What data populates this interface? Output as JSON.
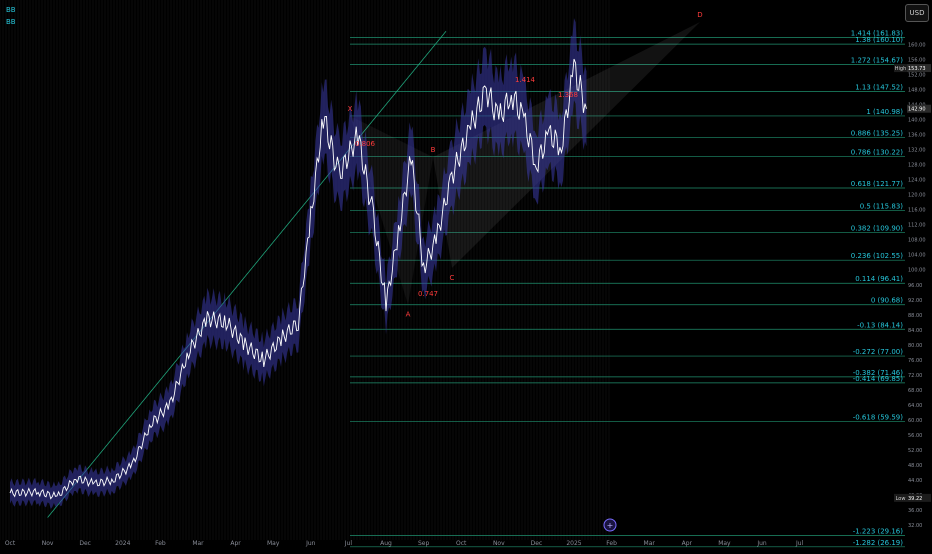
{
  "indicators": [
    "BB",
    "BB"
  ],
  "currency_button": "USD",
  "colors": {
    "background": "#000000",
    "price_line": "#ffffff",
    "band_fill": "#3a3aa8",
    "fib_line": "#1f8f6e",
    "fib_text": "#26c6da",
    "trend_line": "#1fa37a",
    "pattern_label": "#ff3b3b",
    "vertical_grid": "#171717"
  },
  "chart_data": {
    "type": "line",
    "title": "",
    "xlabel": "",
    "ylabel": "",
    "x_tick_labels": [
      "Oct",
      "Nov",
      "Dec",
      "2024",
      "Feb",
      "Mar",
      "Apr",
      "May",
      "Jun",
      "Jul",
      "Aug",
      "Sep",
      "Oct",
      "Nov",
      "Dec",
      "2025",
      "Feb",
      "Mar",
      "Apr",
      "May",
      "Jun",
      "Jul"
    ],
    "y_range": [
      28,
      166
    ],
    "y_tick_labels": [
      "32.00",
      "36.00",
      "40.00",
      "44.00",
      "48.00",
      "52.00",
      "56.00",
      "60.00",
      "64.00",
      "68.00",
      "72.00",
      "76.00",
      "80.00",
      "84.00",
      "88.00",
      "92.00",
      "96.00",
      "100.00",
      "104.00",
      "108.00",
      "112.00",
      "116.00",
      "120.00",
      "124.00",
      "128.00",
      "132.00",
      "136.00",
      "140.00",
      "144.00",
      "148.00",
      "152.00",
      "156.00",
      "160.00"
    ],
    "series": [
      {
        "style": "price",
        "points": [
          [
            "Oct",
            40.5
          ],
          [
            "Nov",
            40.8
          ],
          [
            "Nov",
            39.5
          ],
          [
            "Dec",
            44.5
          ],
          [
            "Dec",
            43.0
          ],
          [
            "2024",
            44.0
          ],
          [
            "2024",
            48.0
          ],
          [
            "Feb",
            59.0
          ],
          [
            "Feb",
            64.0
          ],
          [
            "Mar",
            78.0
          ],
          [
            "Mar",
            87.0
          ],
          [
            "Apr",
            86.0
          ],
          [
            "Apr",
            80.0
          ],
          [
            "May",
            76.0
          ],
          [
            "May",
            82.0
          ],
          [
            "Jun",
            86.0
          ],
          [
            "Jun",
            114.0
          ],
          [
            "Jun",
            141.0
          ],
          [
            "Jul",
            125.0
          ],
          [
            "Jul",
            136.0
          ],
          [
            "Aug",
            114.0
          ],
          [
            "Aug",
            90.7
          ],
          [
            "Aug",
            110.0
          ],
          [
            "Sep",
            130.0
          ],
          [
            "Sep",
            100.5
          ],
          [
            "Sep",
            108.0
          ],
          [
            "Oct",
            125.0
          ],
          [
            "Oct",
            138.0
          ],
          [
            "Nov",
            148.0
          ],
          [
            "Nov",
            140.0
          ],
          [
            "Nov",
            147.0
          ],
          [
            "Dec",
            140.0
          ],
          [
            "Dec",
            128.0
          ],
          [
            "Dec",
            136.0
          ],
          [
            "2025",
            133.0
          ],
          [
            "2025",
            153.73
          ],
          [
            "2025",
            142.9
          ]
        ]
      }
    ],
    "bands_note": "Bollinger Bands overlay around the price line",
    "fib_levels": [
      {
        "ratio": "1.414",
        "price": "161.83"
      },
      {
        "ratio": "1.38",
        "price": "160.10"
      },
      {
        "ratio": "1.272",
        "price": "154.67"
      },
      {
        "ratio": "1.13",
        "price": "147.52"
      },
      {
        "ratio": "1",
        "price": "140.98"
      },
      {
        "ratio": "0.886",
        "price": "135.25"
      },
      {
        "ratio": "0.786",
        "price": "130.22"
      },
      {
        "ratio": "0.618",
        "price": "121.77"
      },
      {
        "ratio": "0.5",
        "price": "115.83"
      },
      {
        "ratio": "0.382",
        "price": "109.90"
      },
      {
        "ratio": "0.236",
        "price": "102.55"
      },
      {
        "ratio": "0.114",
        "price": "96.41"
      },
      {
        "ratio": "0",
        "price": "90.68"
      },
      {
        "ratio": "-0.13",
        "price": "84.14"
      },
      {
        "ratio": "-0.272",
        "price": "77.00"
      },
      {
        "ratio": "-0.382",
        "price": "71.46"
      },
      {
        "ratio": "-0.414",
        "price": "69.85"
      },
      {
        "ratio": "-0.618",
        "price": "59.59"
      },
      {
        "ratio": "-1.223",
        "price": "29.16"
      },
      {
        "ratio": "-1.282",
        "price": "26.19"
      }
    ],
    "pattern_points": [
      {
        "label": "X",
        "x": "Jun",
        "y": 141
      },
      {
        "label": "A",
        "x": "Aug",
        "y": 90.7
      },
      {
        "label": "B",
        "x": "Sep",
        "y": 130
      },
      {
        "label": "C",
        "x": "Sep",
        "y": 100.5
      },
      {
        "label": "D",
        "x": "Mar",
        "y": 166
      }
    ],
    "pattern_ratios": [
      {
        "label": "0.806",
        "x": "Jul",
        "y": 133
      },
      {
        "label": "0.747",
        "x": "Aug",
        "y": 93
      },
      {
        "label": "1.414",
        "x": "Nov",
        "y": 150
      },
      {
        "label": "1.368",
        "x": "Dec",
        "y": 146
      }
    ],
    "price_tags": [
      {
        "label": "High",
        "value": "153.73"
      },
      {
        "label": "",
        "value": "142.90"
      },
      {
        "label": "Low",
        "value": "39.22"
      }
    ],
    "trend_line": {
      "from": [
        "Nov",
        34
      ],
      "to": [
        "Aug",
        163
      ]
    }
  }
}
